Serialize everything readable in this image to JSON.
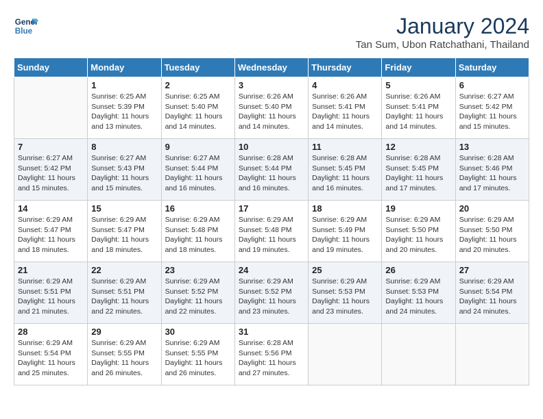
{
  "logo": {
    "line1": "General",
    "line2": "Blue"
  },
  "title": "January 2024",
  "subtitle": "Tan Sum, Ubon Ratchathani, Thailand",
  "weekdays": [
    "Sunday",
    "Monday",
    "Tuesday",
    "Wednesday",
    "Thursday",
    "Friday",
    "Saturday"
  ],
  "weeks": [
    [
      {
        "day": "",
        "info": ""
      },
      {
        "day": "1",
        "info": "Sunrise: 6:25 AM\nSunset: 5:39 PM\nDaylight: 11 hours\nand 13 minutes."
      },
      {
        "day": "2",
        "info": "Sunrise: 6:25 AM\nSunset: 5:40 PM\nDaylight: 11 hours\nand 14 minutes."
      },
      {
        "day": "3",
        "info": "Sunrise: 6:26 AM\nSunset: 5:40 PM\nDaylight: 11 hours\nand 14 minutes."
      },
      {
        "day": "4",
        "info": "Sunrise: 6:26 AM\nSunset: 5:41 PM\nDaylight: 11 hours\nand 14 minutes."
      },
      {
        "day": "5",
        "info": "Sunrise: 6:26 AM\nSunset: 5:41 PM\nDaylight: 11 hours\nand 14 minutes."
      },
      {
        "day": "6",
        "info": "Sunrise: 6:27 AM\nSunset: 5:42 PM\nDaylight: 11 hours\nand 15 minutes."
      }
    ],
    [
      {
        "day": "7",
        "info": ""
      },
      {
        "day": "8",
        "info": "Sunrise: 6:27 AM\nSunset: 5:43 PM\nDaylight: 11 hours\nand 15 minutes."
      },
      {
        "day": "9",
        "info": "Sunrise: 6:27 AM\nSunset: 5:44 PM\nDaylight: 11 hours\nand 16 minutes."
      },
      {
        "day": "10",
        "info": "Sunrise: 6:28 AM\nSunset: 5:44 PM\nDaylight: 11 hours\nand 16 minutes."
      },
      {
        "day": "11",
        "info": "Sunrise: 6:28 AM\nSunset: 5:45 PM\nDaylight: 11 hours\nand 16 minutes."
      },
      {
        "day": "12",
        "info": "Sunrise: 6:28 AM\nSunset: 5:45 PM\nDaylight: 11 hours\nand 17 minutes."
      },
      {
        "day": "13",
        "info": "Sunrise: 6:28 AM\nSunset: 5:46 PM\nDaylight: 11 hours\nand 17 minutes."
      }
    ],
    [
      {
        "day": "14",
        "info": ""
      },
      {
        "day": "15",
        "info": "Sunrise: 6:29 AM\nSunset: 5:47 PM\nDaylight: 11 hours\nand 18 minutes."
      },
      {
        "day": "16",
        "info": "Sunrise: 6:29 AM\nSunset: 5:48 PM\nDaylight: 11 hours\nand 18 minutes."
      },
      {
        "day": "17",
        "info": "Sunrise: 6:29 AM\nSunset: 5:48 PM\nDaylight: 11 hours\nand 19 minutes."
      },
      {
        "day": "18",
        "info": "Sunrise: 6:29 AM\nSunset: 5:49 PM\nDaylight: 11 hours\nand 19 minutes."
      },
      {
        "day": "19",
        "info": "Sunrise: 6:29 AM\nSunset: 5:50 PM\nDaylight: 11 hours\nand 20 minutes."
      },
      {
        "day": "20",
        "info": "Sunrise: 6:29 AM\nSunset: 5:50 PM\nDaylight: 11 hours\nand 20 minutes."
      }
    ],
    [
      {
        "day": "21",
        "info": ""
      },
      {
        "day": "22",
        "info": "Sunrise: 6:29 AM\nSunset: 5:51 PM\nDaylight: 11 hours\nand 22 minutes."
      },
      {
        "day": "23",
        "info": "Sunrise: 6:29 AM\nSunset: 5:52 PM\nDaylight: 11 hours\nand 22 minutes."
      },
      {
        "day": "24",
        "info": "Sunrise: 6:29 AM\nSunset: 5:52 PM\nDaylight: 11 hours\nand 23 minutes."
      },
      {
        "day": "25",
        "info": "Sunrise: 6:29 AM\nSunset: 5:53 PM\nDaylight: 11 hours\nand 23 minutes."
      },
      {
        "day": "26",
        "info": "Sunrise: 6:29 AM\nSunset: 5:53 PM\nDaylight: 11 hours\nand 24 minutes."
      },
      {
        "day": "27",
        "info": "Sunrise: 6:29 AM\nSunset: 5:54 PM\nDaylight: 11 hours\nand 24 minutes."
      }
    ],
    [
      {
        "day": "28",
        "info": ""
      },
      {
        "day": "29",
        "info": "Sunrise: 6:29 AM\nSunset: 5:55 PM\nDaylight: 11 hours\nand 26 minutes."
      },
      {
        "day": "30",
        "info": "Sunrise: 6:29 AM\nSunset: 5:55 PM\nDaylight: 11 hours\nand 26 minutes."
      },
      {
        "day": "31",
        "info": "Sunrise: 6:28 AM\nSunset: 5:56 PM\nDaylight: 11 hours\nand 27 minutes."
      },
      {
        "day": "",
        "info": ""
      },
      {
        "day": "",
        "info": ""
      },
      {
        "day": "",
        "info": ""
      }
    ]
  ],
  "week0_day7_info": "Sunrise: 6:27 AM\nSunset: 5:42 PM\nDaylight: 11 hours\nand 15 minutes.",
  "week1_day0_info": "Sunrise: 6:27 AM\nSunset: 5:42 PM\nDaylight: 11 hours\nand 15 minutes.",
  "week2_day0_info": "Sunrise: 6:29 AM\nSunset: 5:47 PM\nDaylight: 11 hours\nand 18 minutes.",
  "week3_day0_info": "Sunrise: 6:29 AM\nSunset: 5:51 PM\nDaylight: 11 hours\nand 21 minutes.",
  "week4_day0_info": "Sunrise: 6:29 AM\nSunset: 5:54 PM\nDaylight: 11 hours\nand 25 minutes."
}
